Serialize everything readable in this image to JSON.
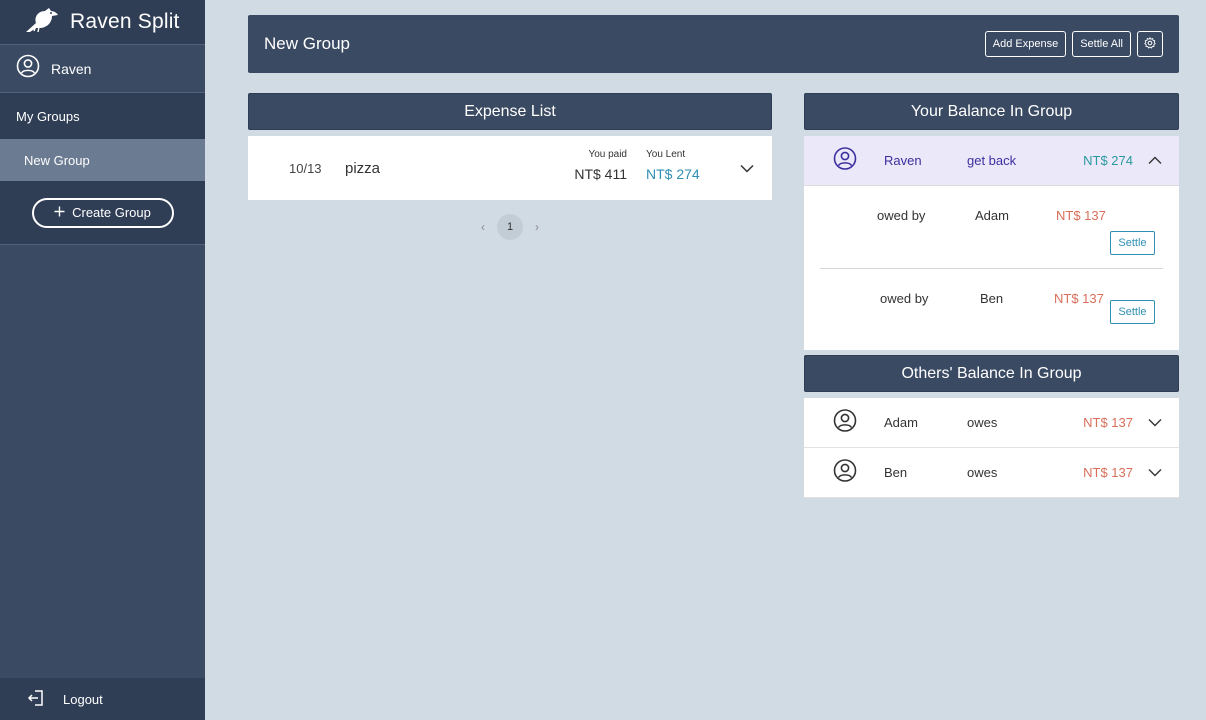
{
  "app": {
    "name": "Raven Split"
  },
  "sidebar": {
    "user_name": "Raven",
    "section_label": "My Groups",
    "groups": [
      {
        "label": "New Group"
      }
    ],
    "create_label": "Create Group",
    "logout_label": "Logout"
  },
  "header": {
    "title": "New Group",
    "add_expense_label": "Add Expense",
    "settle_all_label": "Settle All"
  },
  "expenses": {
    "title": "Expense List",
    "items": [
      {
        "date": "10/13",
        "name": "pizza",
        "paid_label": "You paid",
        "paid_value": "NT$ 411",
        "lent_label": "You Lent",
        "lent_value": "NT$ 274"
      }
    ],
    "pagination": {
      "current_page": "1",
      "prev_symbol": "‹",
      "next_symbol": "›"
    }
  },
  "your_balance": {
    "title": "Your Balance In Group",
    "name": "Raven",
    "verb": "get back",
    "amount": "NT$ 274",
    "owed": [
      {
        "label": "owed by",
        "person": "Adam",
        "amount": "NT$ 137",
        "button": "Settle"
      },
      {
        "label": "owed by",
        "person": "Ben",
        "amount": "NT$ 137",
        "button": "Settle"
      }
    ]
  },
  "others_balance": {
    "title": "Others' Balance In Group",
    "rows": [
      {
        "name": "Adam",
        "verb": "owes",
        "amount": "NT$ 137"
      },
      {
        "name": "Ben",
        "verb": "owes",
        "amount": "NT$ 137"
      }
    ]
  },
  "colors": {
    "navy": "#3a4a62",
    "sidebar_dark": "#2f3d55",
    "background": "#d1dbe4",
    "teal": "#2a9a9e",
    "salmon": "#d86f5a",
    "link_blue": "#2f8fb4",
    "self_row_bg": "#ebe8fa"
  },
  "icons": {
    "brand": "raven-icon",
    "user": "user-circle-icon",
    "create": "plus-icon",
    "logout": "logout-icon",
    "settings": "gear-icon",
    "expand": "chevron-down-icon",
    "collapse": "chevron-up-icon"
  }
}
